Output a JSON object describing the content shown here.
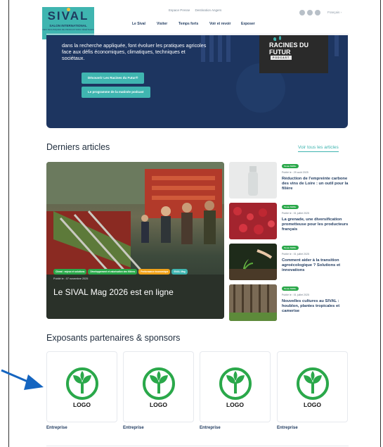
{
  "header": {
    "logo_text": "SIVAL",
    "logo_sub1": "SALON INTERNATIONAL",
    "logo_sub2": "DES TECHNIQUES DE PRODUCTIONS VÉGÉTALES",
    "toplinks": [
      "Espace Presse",
      "Destination Angers"
    ],
    "nav": [
      "Le Sival",
      "Visiter",
      "Temps forts",
      "Voir et revoir",
      "Exposer"
    ],
    "lang": "Français ›"
  },
  "hero": {
    "text": "dans la recherche appliquée, font évoluer les pratiques agricoles face aux défis économiques, climatiques, techniques et sociétaux.",
    "btn1": "Découvrir Les Racines du Futur®",
    "btn2": "Le programme de la matinée podcast",
    "podcast_title": "RACINES DU FUTUR",
    "podcast_badge": "PODCAST"
  },
  "articles": {
    "title": "Derniers articles",
    "see_all": "Voir tous les articles",
    "featured": {
      "tags": [
        {
          "label": "Climat : enjeux et solutions",
          "color": "#2aa84a"
        },
        {
          "label": "Développement et valorisation des filières",
          "color": "#2aa84a"
        },
        {
          "label": "Performance économique",
          "color": "#f0a21a"
        },
        {
          "label": "SIVAL Mag",
          "color": "#3fb5b0"
        }
      ],
      "date": "Publié le : 07 novembre 2025",
      "title": "Le SIVAL Mag 2026 est en ligne"
    },
    "items": [
      {
        "pill": "Vu au SIVAL",
        "date": "Publié le : 29 août 2025",
        "title": "Réduction de l'empreinte carbone des vins de Loire : un outil pour la filière"
      },
      {
        "pill": "Vu au SIVAL",
        "date": "Publié le : 01 juillet 2025",
        "title": "La grenade, une diversification prometteuse pour les producteurs français"
      },
      {
        "pill": "Vu au SIVAL",
        "date": "Publié le : 01 juillet 2025",
        "title": "Comment aider à la transition agroécologique ? Solutions et innovations"
      },
      {
        "pill": "Vu au SIVAL",
        "date": "Publié le : 01 juillet 2025",
        "title": "Nouvelles cultures au SIVAL : houblon, plantes tropicales et camerise"
      }
    ]
  },
  "partners": {
    "title": "Exposants partenaires & sponsors",
    "items": [
      {
        "logo": "LOGO",
        "name": "Entreprise"
      },
      {
        "logo": "LOGO",
        "name": "Entreprise"
      },
      {
        "logo": "LOGO",
        "name": "Entreprise"
      },
      {
        "logo": "LOGO",
        "name": "Entreprise"
      }
    ]
  },
  "colors": {
    "accent": "#3fb5b0",
    "navy": "#1d3560",
    "logo_green": "#2aa84a",
    "arrow": "#1565c0"
  }
}
